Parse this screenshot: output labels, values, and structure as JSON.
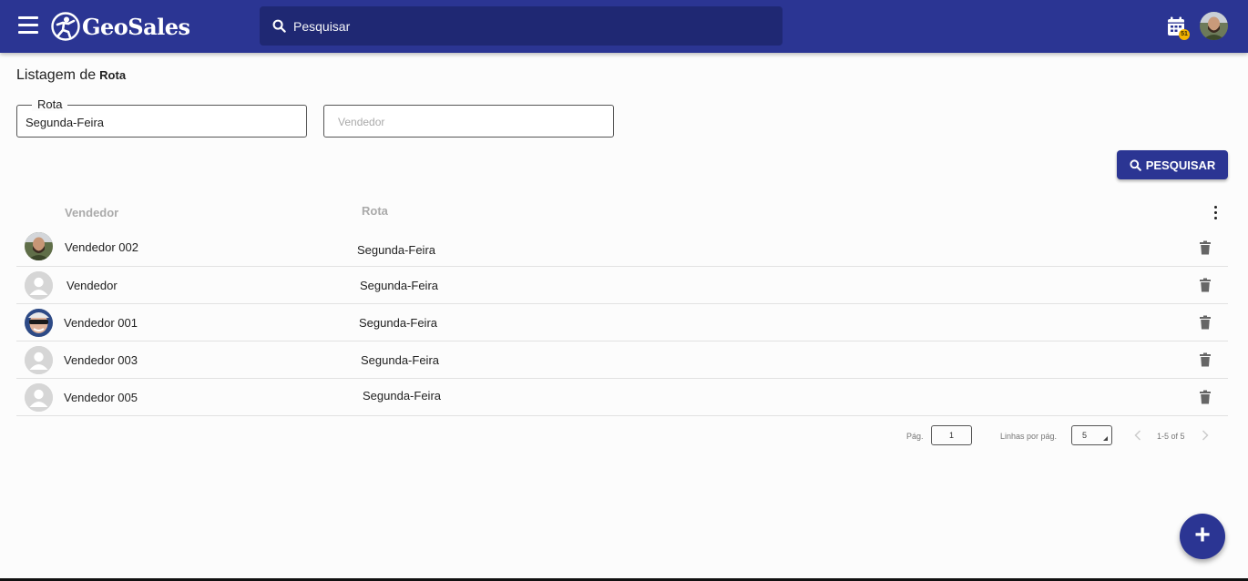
{
  "app": {
    "brand": "GeoSales",
    "calendar_badge": "51"
  },
  "search": {
    "placeholder": "Pesquisar"
  },
  "page": {
    "title_prefix": "Listagem de",
    "title_entity": "Rota"
  },
  "filters": {
    "rota": {
      "label": "Rota",
      "value": "Segunda-Feira"
    },
    "vendedor": {
      "placeholder": "Vendedor"
    }
  },
  "actions": {
    "search_label": "PESQUISAR",
    "add_label": "+"
  },
  "table": {
    "columns": [
      "Vendedor",
      "Rota"
    ],
    "rows": [
      {
        "vendedor": "Vendedor 002",
        "rota": "Segunda-Feira",
        "avatar": "photo-man-beard"
      },
      {
        "vendedor": "Vendedor",
        "rota": "Segunda-Feira",
        "avatar": "default-avatar"
      },
      {
        "vendedor": "Vendedor 001",
        "rota": "Segunda-Feira",
        "avatar": "photo-man-sunglasses"
      },
      {
        "vendedor": "Vendedor 003",
        "rota": "Segunda-Feira",
        "avatar": "default-avatar"
      },
      {
        "vendedor": "Vendedor 005",
        "rota": "Segunda-Feira",
        "avatar": "default-avatar"
      }
    ]
  },
  "pagination": {
    "page_label": "Pág.",
    "page_value": "1",
    "rows_label": "Linhas por pág.",
    "rows_value": "5",
    "range": "1-5 of 5"
  },
  "colors": {
    "primary": "#2b3593",
    "search_bg": "#1f2873",
    "badge": "#f4b400"
  }
}
